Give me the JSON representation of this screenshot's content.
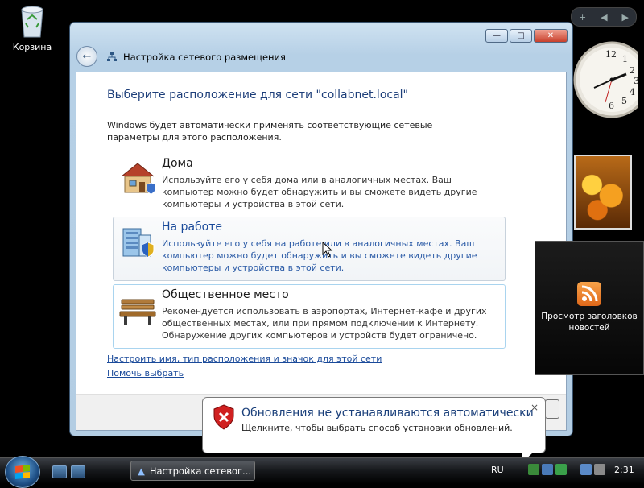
{
  "desktop": {
    "recycle_bin_label": "Корзина"
  },
  "window": {
    "title": "Настройка сетевого размещения",
    "heading": "Выберите расположение для сети \"collabnet.local\"",
    "description": "Windows будет автоматически применять соответствующие сетевые параметры для этого расположения.",
    "options": [
      {
        "title": "Дома",
        "text": "Используйте его у себя дома или в аналогичных местах. Ваш компьютер можно будет обнаружить и вы сможете видеть другие компьютеры и устройства в этой сети.",
        "icon": "house-icon"
      },
      {
        "title": "На работе",
        "text": "Используйте его у себя на работе или в аналогичных местах. Ваш компьютер можно будет обнаружить и вы сможете видеть другие компьютеры и устройства в этой сети.",
        "icon": "office-building-icon"
      },
      {
        "title": "Общественное место",
        "text": "Рекомендуется использовать в аэропортах, Интернет-кафе и других общественных местах, или при прямом подключении к Интернету. Обнаружение других компьютеров и устройств будет ограничено.",
        "icon": "bench-icon"
      }
    ],
    "link_customize": "Настроить имя, тип расположения и значок для этой сети",
    "link_help": "Помочь выбрать"
  },
  "sidebar": {
    "news_gadget_label": "Просмотр заголовков новостей",
    "clock_time": "2:31"
  },
  "balloon": {
    "title": "Обновления не устанавливаются автоматически",
    "text": "Щелкните, чтобы выбрать способ установки обновлений.",
    "close": "×"
  },
  "taskbar": {
    "task_button_label": "Настройка сетевог...",
    "language": "RU",
    "time": "2:31"
  },
  "colors": {
    "heading_blue": "#1e3f7a",
    "link_blue": "#1a4a9a",
    "close_red": "#c8402c",
    "error_red": "#d02020"
  }
}
